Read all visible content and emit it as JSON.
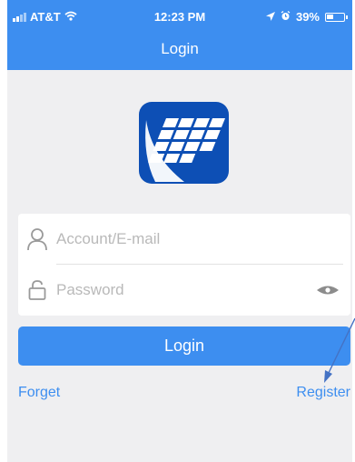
{
  "status_bar": {
    "carrier": "AT&T",
    "time": "12:23 PM",
    "battery": "39%"
  },
  "header": {
    "title": "Login"
  },
  "form": {
    "account_placeholder": "Account/E-mail",
    "password_placeholder": "Password"
  },
  "actions": {
    "login_label": "Login",
    "forget_label": "Forget",
    "register_label": "Register"
  },
  "colors": {
    "accent": "#3d8ef0",
    "logo_bg": "#0d4fb5",
    "screen_bg": "#efeff1"
  },
  "icons": [
    "wifi-icon",
    "location-arrow-icon",
    "alarm-icon",
    "battery-icon",
    "user-icon",
    "lock-icon",
    "eye-icon"
  ]
}
